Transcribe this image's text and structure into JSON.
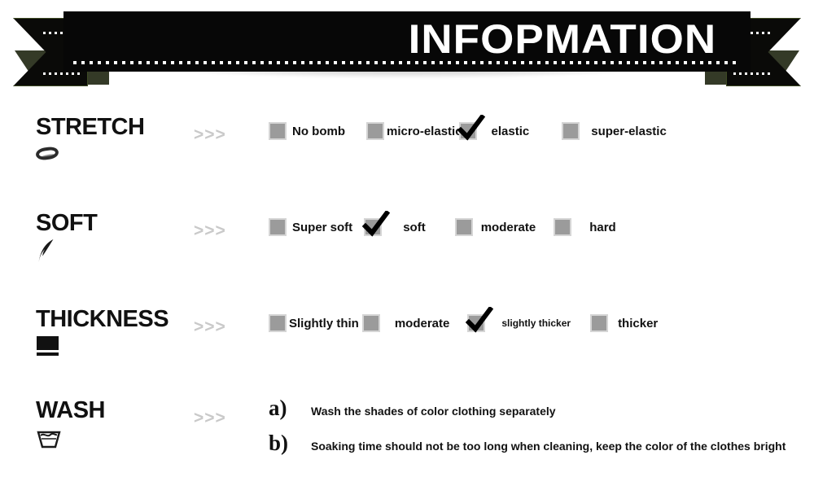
{
  "banner": {
    "title": "INFOPMATION"
  },
  "arrows_glyph": ">>>",
  "rows": [
    {
      "title": "STRETCH",
      "icon": "elastic-band-icon",
      "options": [
        {
          "label": "No bomb",
          "checked": false,
          "small": false
        },
        {
          "label": "micro-elastic",
          "checked": false,
          "small": false
        },
        {
          "label": "elastic",
          "checked": true,
          "small": false
        },
        {
          "label": "super-elastic",
          "checked": false,
          "small": false
        }
      ]
    },
    {
      "title": "SOFT",
      "icon": "feather-icon",
      "options": [
        {
          "label": "Super soft",
          "checked": false,
          "small": false
        },
        {
          "label": "soft",
          "checked": true,
          "small": false
        },
        {
          "label": "moderate",
          "checked": false,
          "small": false
        },
        {
          "label": "hard",
          "checked": false,
          "small": false
        }
      ]
    },
    {
      "title": "THICKNESS",
      "icon": "fabric-layer-icon",
      "options": [
        {
          "label": "Slightly thin",
          "checked": false,
          "small": false
        },
        {
          "label": "moderate",
          "checked": false,
          "small": false
        },
        {
          "label": "slightly thicker",
          "checked": true,
          "small": true
        },
        {
          "label": "thicker",
          "checked": false,
          "small": false
        }
      ]
    },
    {
      "title": "WASH",
      "icon": "wash-tub-icon",
      "instructions": [
        {
          "marker": "a)",
          "text": "Wash the shades of color clothing separately"
        },
        {
          "marker": "b)",
          "text": "Soaking time should not be too long when cleaning, keep the color of the clothes bright"
        }
      ]
    }
  ],
  "colors": {
    "banner_bg": "#070707",
    "banner_edge": "#3e4a24",
    "checkbox_fill": "#9b9b9b",
    "checkbox_border": "#d5d5d5",
    "arrow_gray": "#c9c9c9",
    "text_black": "#111111"
  }
}
